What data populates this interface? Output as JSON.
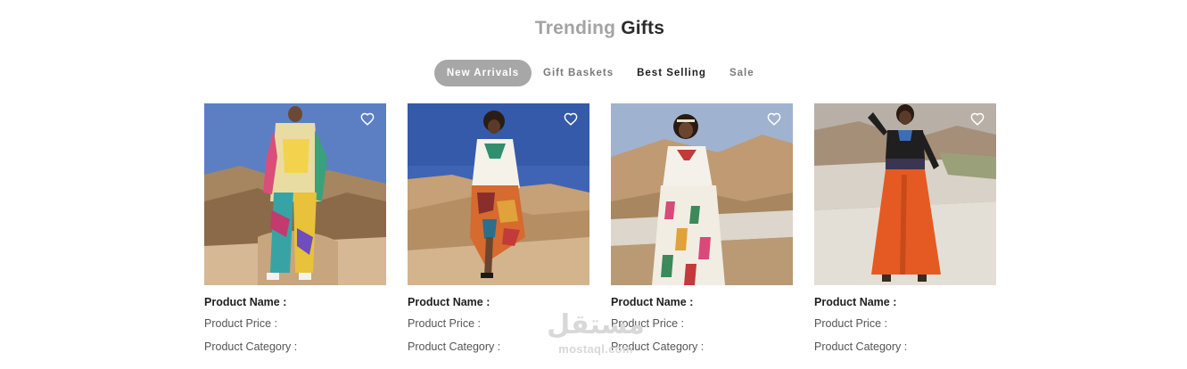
{
  "section": {
    "title_light": "Trending",
    "title_dark": "Gifts"
  },
  "tabs": [
    {
      "label": "New Arrivals",
      "active": true
    },
    {
      "label": "Gift Baskets",
      "active": false
    },
    {
      "label": "Best Selling",
      "active": false
    },
    {
      "label": "Sale",
      "active": false
    }
  ],
  "products": [
    {
      "name": "Product Name :",
      "price": "Product Price :",
      "category": "Product Category :",
      "outfit": "printed satin suit"
    },
    {
      "name": "Product Name :",
      "price": "Product Price :",
      "category": "Product Category :",
      "outfit": "white blouse, patchwork skirt"
    },
    {
      "name": "Product Name :",
      "price": "Product Price :",
      "category": "Product Category :",
      "outfit": "embroidered white dress"
    },
    {
      "name": "Product Name :",
      "price": "Product Price :",
      "category": "Product Category :",
      "outfit": "black top, orange skirt"
    }
  ],
  "icons": {
    "favorite": "heart-outline-icon"
  },
  "watermark": {
    "logo": "مستقل",
    "url": "mostaql.com"
  },
  "colors": {
    "accent_active_tab": "#a7a7a7",
    "title_light": "#a3a3a3",
    "title_dark": "#2b2b2b",
    "sky": "#8fa6c9",
    "sand": "#c9a77f"
  }
}
